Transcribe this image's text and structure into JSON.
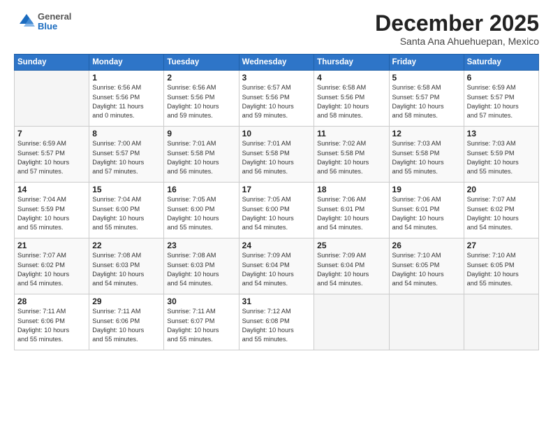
{
  "header": {
    "logo_general": "General",
    "logo_blue": "Blue",
    "month_title": "December 2025",
    "location": "Santa Ana Ahuehuepan, Mexico"
  },
  "days_of_week": [
    "Sunday",
    "Monday",
    "Tuesday",
    "Wednesday",
    "Thursday",
    "Friday",
    "Saturday"
  ],
  "weeks": [
    [
      {
        "day": "",
        "info": ""
      },
      {
        "day": "1",
        "info": "Sunrise: 6:56 AM\nSunset: 5:56 PM\nDaylight: 11 hours\nand 0 minutes."
      },
      {
        "day": "2",
        "info": "Sunrise: 6:56 AM\nSunset: 5:56 PM\nDaylight: 10 hours\nand 59 minutes."
      },
      {
        "day": "3",
        "info": "Sunrise: 6:57 AM\nSunset: 5:56 PM\nDaylight: 10 hours\nand 59 minutes."
      },
      {
        "day": "4",
        "info": "Sunrise: 6:58 AM\nSunset: 5:56 PM\nDaylight: 10 hours\nand 58 minutes."
      },
      {
        "day": "5",
        "info": "Sunrise: 6:58 AM\nSunset: 5:57 PM\nDaylight: 10 hours\nand 58 minutes."
      },
      {
        "day": "6",
        "info": "Sunrise: 6:59 AM\nSunset: 5:57 PM\nDaylight: 10 hours\nand 57 minutes."
      }
    ],
    [
      {
        "day": "7",
        "info": "Sunrise: 6:59 AM\nSunset: 5:57 PM\nDaylight: 10 hours\nand 57 minutes."
      },
      {
        "day": "8",
        "info": "Sunrise: 7:00 AM\nSunset: 5:57 PM\nDaylight: 10 hours\nand 57 minutes."
      },
      {
        "day": "9",
        "info": "Sunrise: 7:01 AM\nSunset: 5:58 PM\nDaylight: 10 hours\nand 56 minutes."
      },
      {
        "day": "10",
        "info": "Sunrise: 7:01 AM\nSunset: 5:58 PM\nDaylight: 10 hours\nand 56 minutes."
      },
      {
        "day": "11",
        "info": "Sunrise: 7:02 AM\nSunset: 5:58 PM\nDaylight: 10 hours\nand 56 minutes."
      },
      {
        "day": "12",
        "info": "Sunrise: 7:03 AM\nSunset: 5:58 PM\nDaylight: 10 hours\nand 55 minutes."
      },
      {
        "day": "13",
        "info": "Sunrise: 7:03 AM\nSunset: 5:59 PM\nDaylight: 10 hours\nand 55 minutes."
      }
    ],
    [
      {
        "day": "14",
        "info": "Sunrise: 7:04 AM\nSunset: 5:59 PM\nDaylight: 10 hours\nand 55 minutes."
      },
      {
        "day": "15",
        "info": "Sunrise: 7:04 AM\nSunset: 6:00 PM\nDaylight: 10 hours\nand 55 minutes."
      },
      {
        "day": "16",
        "info": "Sunrise: 7:05 AM\nSunset: 6:00 PM\nDaylight: 10 hours\nand 55 minutes."
      },
      {
        "day": "17",
        "info": "Sunrise: 7:05 AM\nSunset: 6:00 PM\nDaylight: 10 hours\nand 54 minutes."
      },
      {
        "day": "18",
        "info": "Sunrise: 7:06 AM\nSunset: 6:01 PM\nDaylight: 10 hours\nand 54 minutes."
      },
      {
        "day": "19",
        "info": "Sunrise: 7:06 AM\nSunset: 6:01 PM\nDaylight: 10 hours\nand 54 minutes."
      },
      {
        "day": "20",
        "info": "Sunrise: 7:07 AM\nSunset: 6:02 PM\nDaylight: 10 hours\nand 54 minutes."
      }
    ],
    [
      {
        "day": "21",
        "info": "Sunrise: 7:07 AM\nSunset: 6:02 PM\nDaylight: 10 hours\nand 54 minutes."
      },
      {
        "day": "22",
        "info": "Sunrise: 7:08 AM\nSunset: 6:03 PM\nDaylight: 10 hours\nand 54 minutes."
      },
      {
        "day": "23",
        "info": "Sunrise: 7:08 AM\nSunset: 6:03 PM\nDaylight: 10 hours\nand 54 minutes."
      },
      {
        "day": "24",
        "info": "Sunrise: 7:09 AM\nSunset: 6:04 PM\nDaylight: 10 hours\nand 54 minutes."
      },
      {
        "day": "25",
        "info": "Sunrise: 7:09 AM\nSunset: 6:04 PM\nDaylight: 10 hours\nand 54 minutes."
      },
      {
        "day": "26",
        "info": "Sunrise: 7:10 AM\nSunset: 6:05 PM\nDaylight: 10 hours\nand 54 minutes."
      },
      {
        "day": "27",
        "info": "Sunrise: 7:10 AM\nSunset: 6:05 PM\nDaylight: 10 hours\nand 55 minutes."
      }
    ],
    [
      {
        "day": "28",
        "info": "Sunrise: 7:11 AM\nSunset: 6:06 PM\nDaylight: 10 hours\nand 55 minutes."
      },
      {
        "day": "29",
        "info": "Sunrise: 7:11 AM\nSunset: 6:06 PM\nDaylight: 10 hours\nand 55 minutes."
      },
      {
        "day": "30",
        "info": "Sunrise: 7:11 AM\nSunset: 6:07 PM\nDaylight: 10 hours\nand 55 minutes."
      },
      {
        "day": "31",
        "info": "Sunrise: 7:12 AM\nSunset: 6:08 PM\nDaylight: 10 hours\nand 55 minutes."
      },
      {
        "day": "",
        "info": ""
      },
      {
        "day": "",
        "info": ""
      },
      {
        "day": "",
        "info": ""
      }
    ]
  ]
}
